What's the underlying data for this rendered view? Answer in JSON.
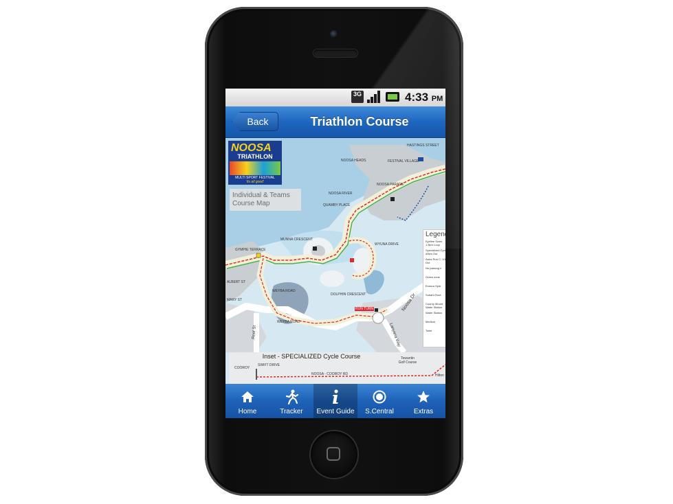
{
  "status_bar": {
    "network": "3G",
    "time": "4:33",
    "ampm": "PM"
  },
  "nav": {
    "back_label": "Back",
    "title": "Triathlon Course"
  },
  "map": {
    "logo_name": "NOOSA",
    "logo_event": "TRIATHLON",
    "logo_sub": "MULTI SPORT FESTIVAL",
    "logo_tag": "'its all good'",
    "course_label": "Individual & Teams Course Map",
    "places": {
      "hastings": "HASTINGS STREET",
      "heads": "NOOSA HEADS",
      "festival": "FESTIVAL VILLAGE",
      "parade": "NOOSA PARADE",
      "river": "NOOSA RIVER",
      "quamby": "QUAMBY PLACE",
      "munna": "MUNNA CRESCENT",
      "wyuna": "WYUNA DRIVE",
      "gympie": "GYMPIE TERRACE",
      "albert": "ALBERT ST",
      "mary": "MARY ST",
      "weyba": "WEYBA ROAD",
      "dolphin": "DOLPHIN CRESCENT",
      "noosa_dr": "Noosa Dr",
      "lanyana": "Lanyana Way",
      "reef": "Reef St",
      "run_turn": "RUN TURN",
      "swift": "SWIFT DRIVE",
      "cooroy": "COOROY",
      "noosa_cooroy": "NOOSA - COOROY RD",
      "tewantin": "Tewantin Golf Course",
      "hilton": "Hilton"
    },
    "legend": {
      "title": "Legend",
      "items": [
        "Eyeline Swim 1.5km Loop",
        "Specialized Cycle 40km Out",
        "Asics Run C. 10km Out",
        "No passing z",
        "Green zone",
        "Endura Hydr",
        "Subaru Rout",
        "Cooroy Mount Water Station",
        "Water Station",
        "Medical",
        "Toilet"
      ]
    },
    "inset_title": "Inset - SPECIALIZED Cycle Course"
  },
  "tabs": [
    {
      "label": "Home",
      "icon": "home-icon",
      "active": false
    },
    {
      "label": "Tracker",
      "icon": "runner-icon",
      "active": false
    },
    {
      "label": "Event Guide",
      "icon": "info-icon",
      "active": true
    },
    {
      "label": "S.Central",
      "icon": "target-icon",
      "active": false
    },
    {
      "label": "Extras",
      "icon": "star-icon",
      "active": false
    }
  ]
}
